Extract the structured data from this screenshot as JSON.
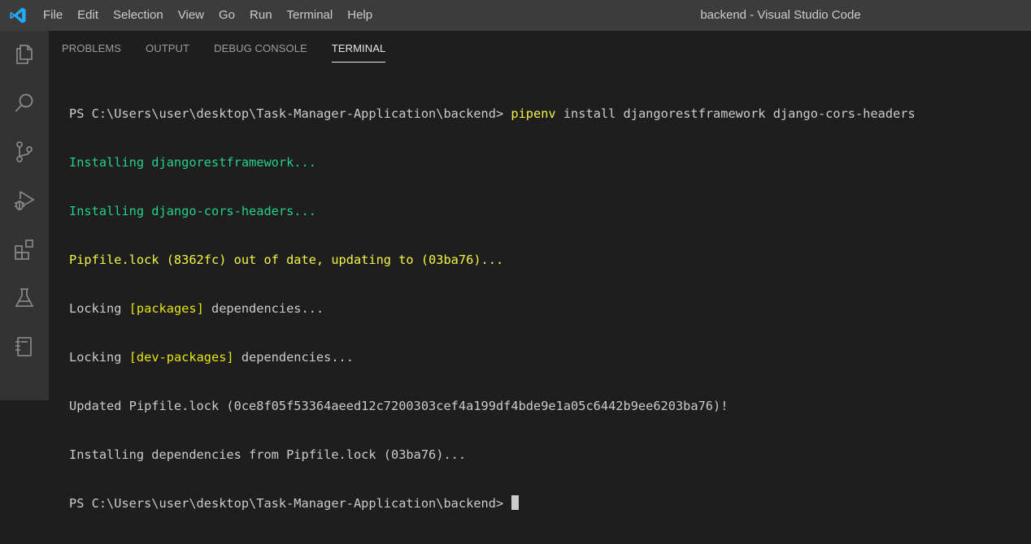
{
  "window": {
    "title": "backend - Visual Studio Code"
  },
  "menu": {
    "items": [
      "File",
      "Edit",
      "Selection",
      "View",
      "Go",
      "Run",
      "Terminal",
      "Help"
    ]
  },
  "activity_bar": {
    "icons": [
      "explorer-icon",
      "search-icon",
      "source-control-icon",
      "run-debug-icon",
      "extensions-icon",
      "testing-icon",
      "notebook-icon"
    ]
  },
  "panel": {
    "tabs": [
      "PROBLEMS",
      "OUTPUT",
      "DEBUG CONSOLE",
      "TERMINAL"
    ],
    "active_tab": "TERMINAL"
  },
  "terminal": {
    "prompt": "PS C:\\Users\\user\\desktop\\Task-Manager-Application\\backend> ",
    "command_name": "pipenv",
    "command_args": " install djangorestframework django-cors-headers",
    "line_installing_1": "Installing djangorestframework...",
    "line_installing_2": "Installing django-cors-headers...",
    "line_pipfile_lock": "Pipfile.lock (8362fc) out of date, updating to (03ba76)...",
    "locking_1_prefix": "Locking ",
    "locking_1_tag": "[packages]",
    "locking_1_suffix": " dependencies...",
    "locking_2_prefix": "Locking ",
    "locking_2_tag": "[dev-packages]",
    "locking_2_suffix": " dependencies...",
    "line_updated": "Updated Pipfile.lock (0ce8f05f53364aeed12c7200303cef4a199df4bde9e1a05c6442b9ee6203ba76)!",
    "line_installing_deps": "Installing dependencies from Pipfile.lock (03ba76)...",
    "prompt_final": "PS C:\\Users\\user\\desktop\\Task-Manager-Application\\backend> "
  },
  "colors": {
    "titlebar": "#3c3c3c",
    "activitybar": "#333333",
    "panel": "#1e1e1e",
    "terminal_green": "#23d18b",
    "terminal_yellow": "#f5f543",
    "vscode_blue": "#23a9f2"
  }
}
